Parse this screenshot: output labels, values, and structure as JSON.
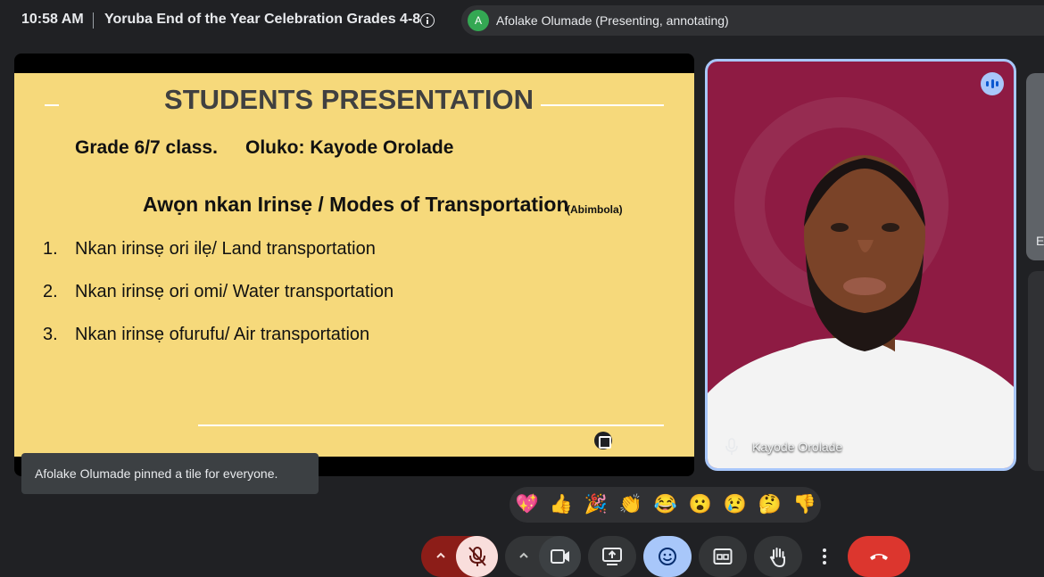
{
  "topbar": {
    "time": "10:58 AM",
    "meeting_title": "Yoruba End of the Year Celebration Grades 4-8",
    "presenter_initial": "A",
    "presenter_label": "Afolake Olumade (Presenting, annotating)"
  },
  "slide": {
    "title": "STUDENTS PRESENTATION",
    "class_label": "Grade 6/7 class.",
    "teacher_label": "Oluko: Kayode Orolade",
    "heading": "Awọn nkan Irinsẹ / Modes of Transportation",
    "heading_note": "(Abimbola)",
    "items": [
      {
        "num": "1.",
        "text": "Nkan irinsẹ ori ilẹ/ Land transportation"
      },
      {
        "num": "2.",
        "text": "Nkan irinsẹ ori omi/ Water transportation"
      },
      {
        "num": "3.",
        "text": "Nkan irinsẹ ofurufu/ Air transportation"
      }
    ]
  },
  "participant": {
    "name": "Kayode Orolade",
    "speaking": true
  },
  "side_tile": {
    "initial": "E"
  },
  "toast": {
    "message": "Afolake Olumade pinned a tile for everyone."
  },
  "reactions": [
    "💖",
    "👍",
    "🎉",
    "👏",
    "😂",
    "😮",
    "😢",
    "🤔",
    "👎"
  ],
  "controls": {
    "mic": "muted",
    "camera": "on",
    "end_color": "#dc362e",
    "accent": "#a8c7fa"
  }
}
